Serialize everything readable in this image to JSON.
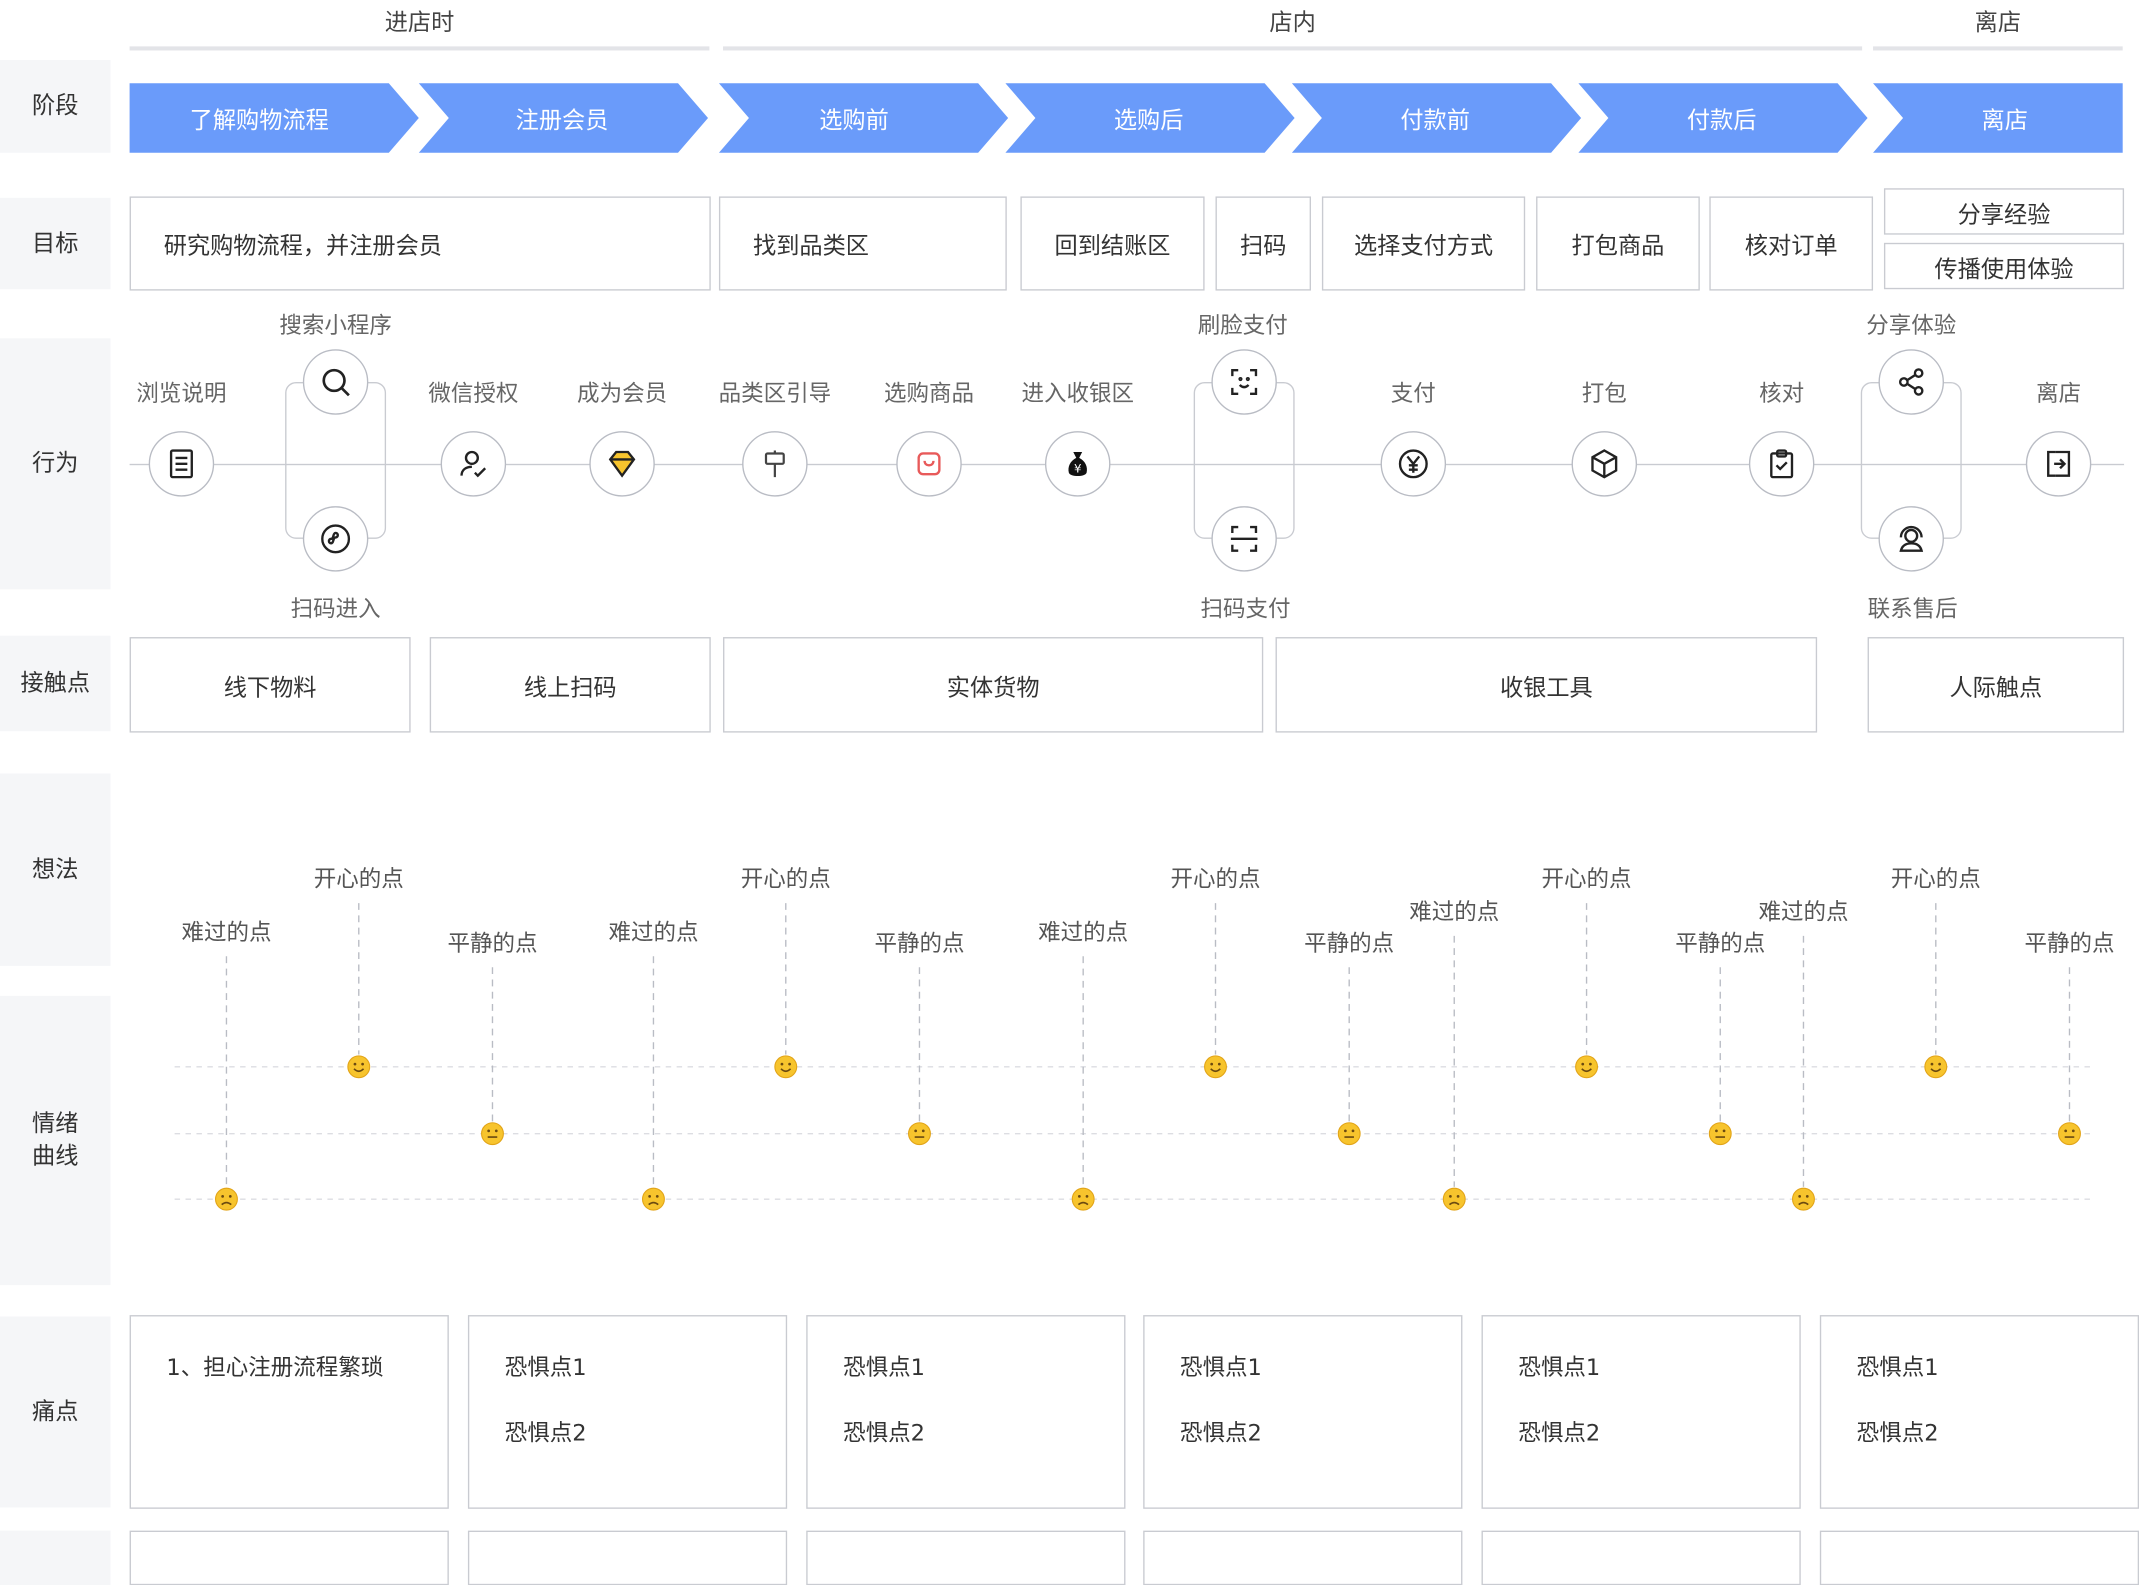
{
  "phases": [
    "进店时",
    "店内",
    "离店"
  ],
  "row_labels": {
    "stage": "阶段",
    "goal": "目标",
    "behavior": "行为",
    "touchpoint": "接触点",
    "thought": "想法",
    "emotion_line1": "情绪",
    "emotion_line2": "曲线",
    "pain": "痛点"
  },
  "stages": [
    "了解购物流程",
    "注册会员",
    "选购前",
    "选购后",
    "付款前",
    "付款后",
    "离店"
  ],
  "goals": [
    "研究购物流程，并注册会员",
    "找到品类区",
    "回到结账区",
    "扫码",
    "选择支付方式",
    "打包商品",
    "核对订单",
    "分享经验",
    "传播使用体验"
  ],
  "actions": {
    "browse": "浏览说明",
    "search_mini": "搜索小程序",
    "scan_enter": "扫码进入",
    "wechat_auth": "微信授权",
    "member": "成为会员",
    "guide": "品类区引导",
    "select": "选购商品",
    "checkout": "进入收银区",
    "face_pay": "刷脸支付",
    "scan_pay": "扫码支付",
    "pay": "支付",
    "pack": "打包",
    "check": "核对",
    "share": "分享体验",
    "after_sale": "联系售后",
    "leave": "离店"
  },
  "icons": {
    "browse": "document-icon",
    "search_mini": "search-icon",
    "scan_enter": "mini-program-icon",
    "wechat_auth": "user-check-icon",
    "member": "diamond-icon",
    "guide": "signpost-icon",
    "select": "shopping-bag-icon",
    "checkout": "money-bag-icon",
    "face_pay": "face-scan-icon",
    "scan_pay": "scan-icon",
    "pay": "yen-icon",
    "pack": "box-icon",
    "check": "clipboard-check-icon",
    "share": "share-icon",
    "after_sale": "headset-user-icon",
    "leave": "exit-icon"
  },
  "touchpoints": [
    "线下物料",
    "线上扫码",
    "实体货物",
    "收银工具",
    "人际触点"
  ],
  "emotion_labels": {
    "happy": "开心的点",
    "calm": "平静的点",
    "sad": "难过的点"
  },
  "emotion_points": [
    "sad",
    "happy",
    "calm",
    "sad",
    "happy",
    "calm",
    "sad",
    "happy",
    "calm",
    "sad",
    "happy",
    "calm",
    "sad",
    "happy",
    "calm"
  ],
  "pains": [
    [
      "1、担心注册流程繁琐"
    ],
    [
      "恐惧点1",
      "恐惧点2"
    ],
    [
      "恐惧点1",
      "恐惧点2"
    ],
    [
      "恐惧点1",
      "恐惧点2"
    ],
    [
      "恐惧点1",
      "恐惧点2"
    ],
    [
      "恐惧点1",
      "恐惧点2"
    ]
  ],
  "colors": {
    "stage_fill": "#6a9bfa",
    "row_label_bg": "#f5f6f8",
    "emoji_face": "#f7c42d"
  }
}
